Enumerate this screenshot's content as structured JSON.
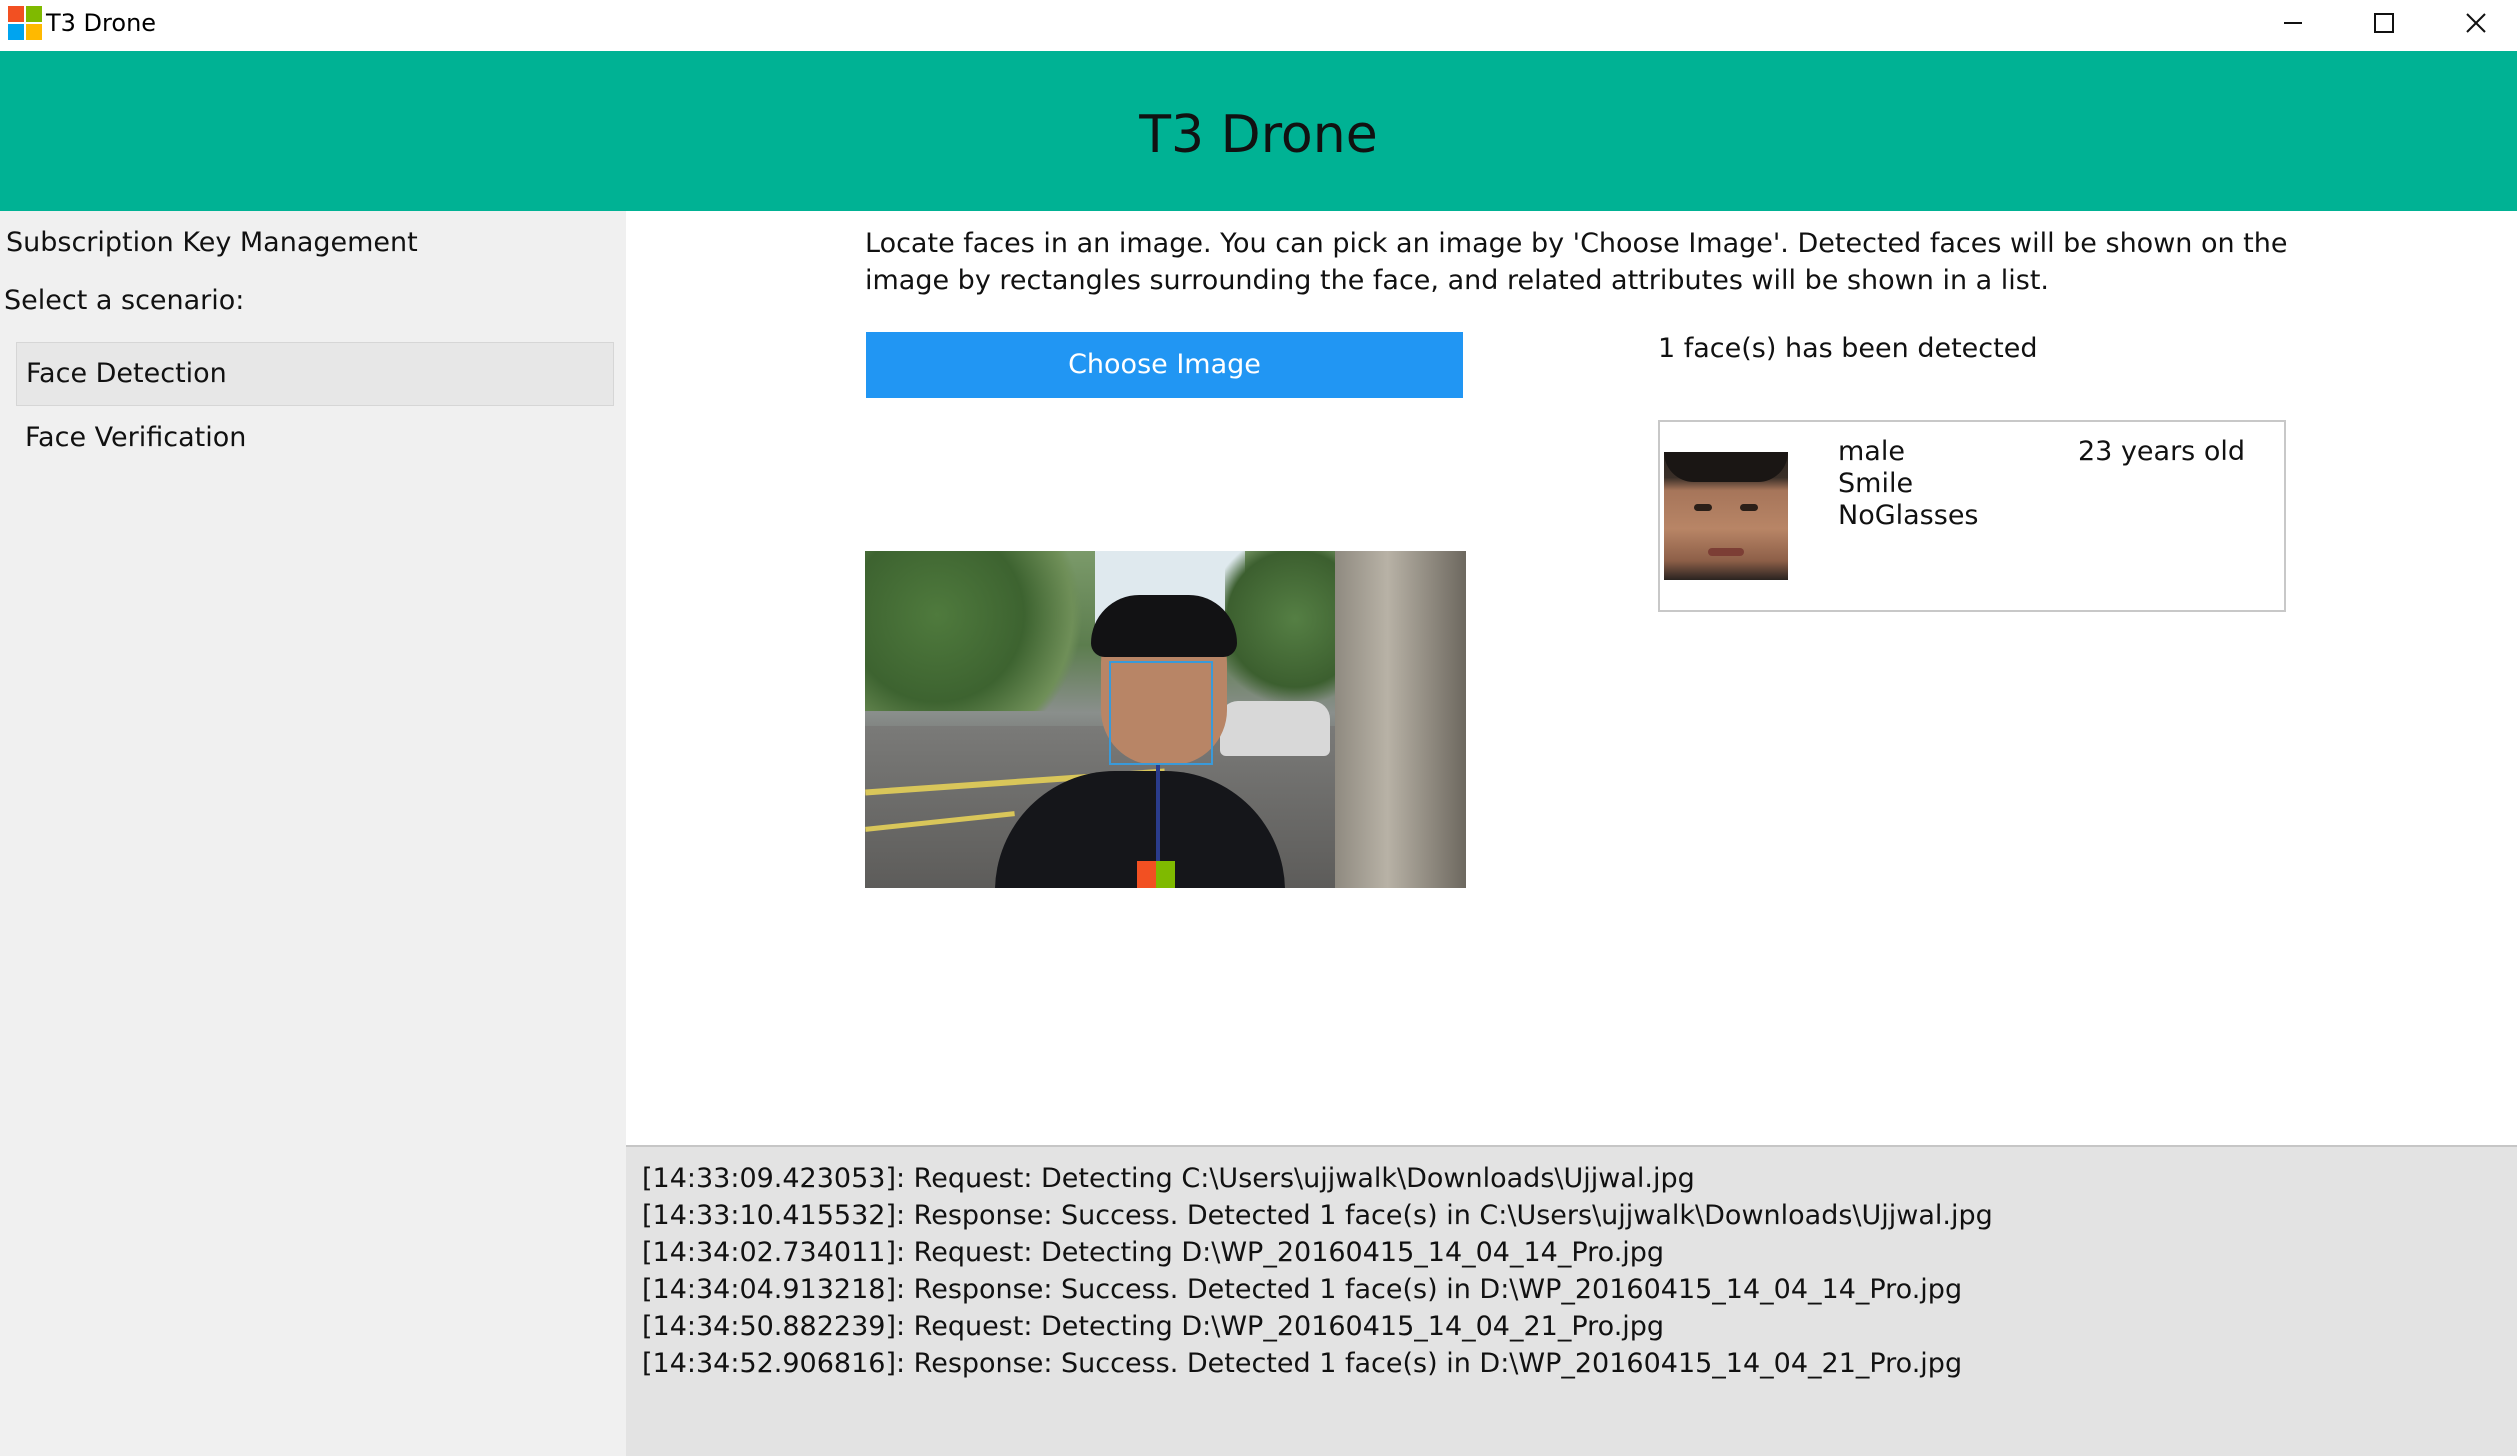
{
  "window": {
    "title": "T3 Drone",
    "controls": {
      "minimize": "minimize-icon",
      "maximize": "maximize-icon",
      "close": "close-icon"
    }
  },
  "banner": {
    "title": "T3 Drone",
    "color": "#00b294"
  },
  "sidebar": {
    "subscription_key": "Subscription Key Management",
    "scenario_label": "Select a scenario:",
    "scenarios": [
      {
        "label": "Face Detection",
        "selected": true
      },
      {
        "label": "Face Verification",
        "selected": false
      }
    ]
  },
  "main": {
    "description": "Locate faces in an image. You can pick an image by 'Choose Image'. Detected faces will be shown on the image by rectangles surrounding the face, and related attributes will be shown in a list.",
    "choose_button": "Choose Image",
    "button_color": "#2196f3",
    "detected_count": "1 face(s) has been detected",
    "faces": [
      {
        "gender": "male",
        "age": "23 years old",
        "expression": "Smile",
        "glasses": "NoGlasses"
      }
    ]
  },
  "log": {
    "lines": [
      "[14:33:09.423053]: Request: Detecting C:\\Users\\ujjwalk\\Downloads\\Ujjwal.jpg",
      "[14:33:10.415532]: Response: Success. Detected 1 face(s) in C:\\Users\\ujjwalk\\Downloads\\Ujjwal.jpg",
      "[14:34:02.734011]: Request: Detecting D:\\WP_20160415_14_04_14_Pro.jpg",
      "[14:34:04.913218]: Response: Success. Detected 1 face(s) in D:\\WP_20160415_14_04_14_Pro.jpg",
      "[14:34:50.882239]: Request: Detecting D:\\WP_20160415_14_04_21_Pro.jpg",
      "[14:34:52.906816]: Response: Success. Detected 1 face(s) in D:\\WP_20160415_14_04_21_Pro.jpg"
    ]
  }
}
